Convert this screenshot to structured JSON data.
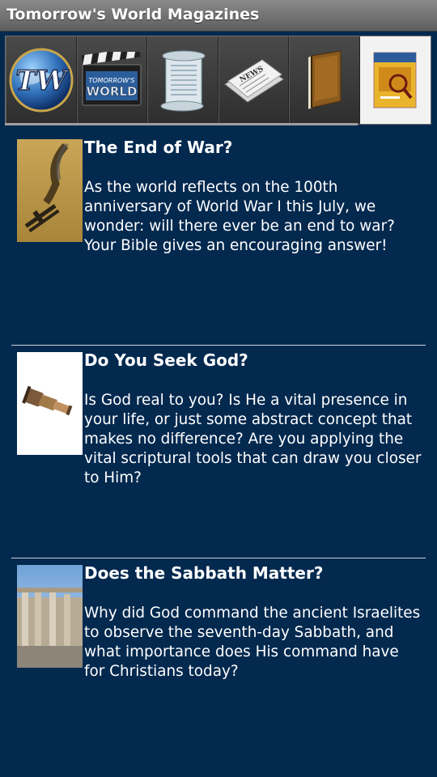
{
  "app": {
    "title": "Tomorrow's World Magazines"
  },
  "tabs": [
    {
      "id": "tw-globe",
      "icon": "tw-globe-logo-icon",
      "selected": false
    },
    {
      "id": "tw-tv",
      "icon": "tomorrows-world-tv-clapperboard-icon",
      "label": "TOMORROW'S WORLD",
      "selected": false
    },
    {
      "id": "scroll",
      "icon": "scroll-icon",
      "selected": false
    },
    {
      "id": "news",
      "icon": "newspaper-icon",
      "selected": false
    },
    {
      "id": "book",
      "icon": "book-icon",
      "selected": false
    },
    {
      "id": "magazine",
      "icon": "magazine-cover-icon",
      "selected": true
    }
  ],
  "articles": [
    {
      "title": "The End of War?",
      "summary": "As the world reflects on the 100th anniversary of World War I this July, we wonder: will there ever be an end to war? Your Bible gives an encouraging answer!",
      "thumb": "falling-biplane-thumbnail"
    },
    {
      "title": "Do You Seek God?",
      "summary": "Is God real to you? Is He a vital presence in your life, or just some abstract concept that makes no difference? Are you applying the vital scriptural tools that can draw you closer to Him?",
      "thumb": "spyglass-thumbnail"
    },
    {
      "title": "Does the Sabbath Matter?",
      "summary": "Why did God command the ancient Israelites to observe the seventh-day Sabbath, and what importance does His command have for Christians today?",
      "thumb": "ancient-ruins-thumbnail"
    }
  ],
  "colors": {
    "background": "#03294f",
    "titlebar": "#6e6e6e",
    "divider": "#c9d3dd"
  }
}
